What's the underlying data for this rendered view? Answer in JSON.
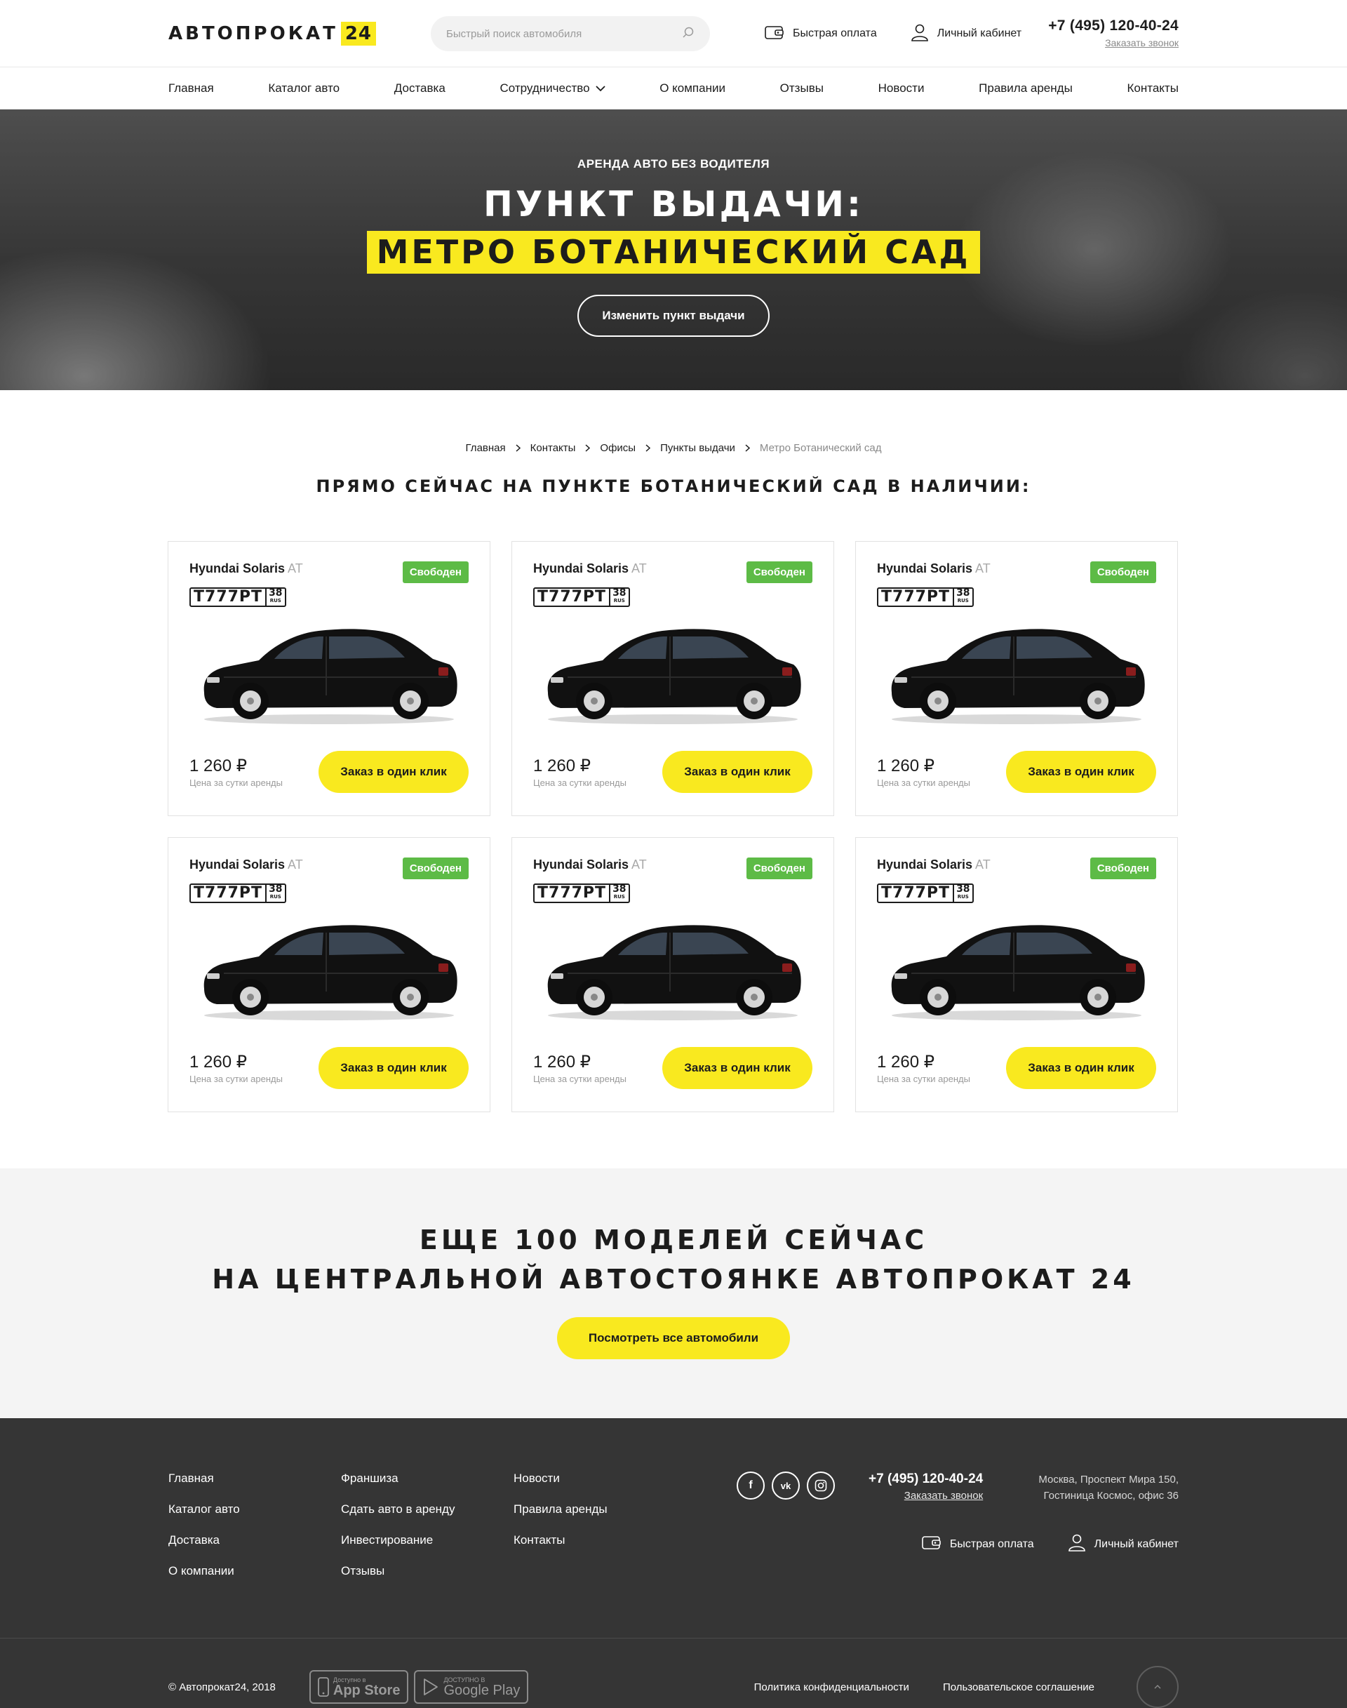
{
  "header": {
    "logo_text": "АВТОПРОКАТ",
    "logo_num": "24",
    "search_placeholder": "Быстрый поиск автомобиля",
    "pay_label": "Быстрая оплата",
    "cabinet_label": "Личный кабинет",
    "phone": "+7 (495) 120-40-24",
    "callback": "Заказать звонок"
  },
  "nav": {
    "items": [
      "Главная",
      "Каталог авто",
      "Доставка",
      "Сотрудничество",
      "О компании",
      "Отзывы",
      "Новости",
      "Правила аренды",
      "Контакты"
    ]
  },
  "hero": {
    "kicker": "АРЕНДА АВТО БЕЗ ВОДИТЕЛЯ",
    "title": "ПУНКТ ВЫДАЧИ:",
    "subtitle": "МЕТРО БОТАНИЧЕСКИЙ САД",
    "button": "Изменить пункт выдачи"
  },
  "breadcrumbs": [
    "Главная",
    "Контакты",
    "Офисы",
    "Пункты выдачи",
    "Метро Ботанический сад"
  ],
  "section_title": "ПРЯМО СЕЙЧАС НА ПУНКТЕ БОТАНИЧЕСКИЙ САД В НАЛИЧИИ:",
  "cards": [
    {
      "name": "Hyundai Solaris",
      "trans": "AT",
      "status": "Свободен",
      "plate": "Т777РТ",
      "region": "38",
      "rus": "RUS",
      "price": "1 260 ₽",
      "price_note": "Цена за сутки аренды",
      "button": "Заказ в один клик"
    },
    {
      "name": "Hyundai Solaris",
      "trans": "AT",
      "status": "Свободен",
      "plate": "Т777РТ",
      "region": "38",
      "rus": "RUS",
      "price": "1 260 ₽",
      "price_note": "Цена за сутки аренды",
      "button": "Заказ в один клик"
    },
    {
      "name": "Hyundai Solaris",
      "trans": "AT",
      "status": "Свободен",
      "plate": "Т777РТ",
      "region": "38",
      "rus": "RUS",
      "price": "1 260 ₽",
      "price_note": "Цена за сутки аренды",
      "button": "Заказ в один клик"
    },
    {
      "name": "Hyundai Solaris",
      "trans": "AT",
      "status": "Свободен",
      "plate": "Т777РТ",
      "region": "38",
      "rus": "RUS",
      "price": "1 260 ₽",
      "price_note": "Цена за сутки аренды",
      "button": "Заказ в один клик"
    },
    {
      "name": "Hyundai Solaris",
      "trans": "AT",
      "status": "Свободен",
      "plate": "Т777РТ",
      "region": "38",
      "rus": "RUS",
      "price": "1 260 ₽",
      "price_note": "Цена за сутки аренды",
      "button": "Заказ в один клик"
    },
    {
      "name": "Hyundai Solaris",
      "trans": "AT",
      "status": "Свободен",
      "plate": "Т777РТ",
      "region": "38",
      "rus": "RUS",
      "price": "1 260 ₽",
      "price_note": "Цена за сутки аренды",
      "button": "Заказ в один клик"
    }
  ],
  "more": {
    "line1": "ЕЩЕ 100 МОДЕЛЕЙ СЕЙЧАС",
    "line2": "НА ЦЕНТРАЛЬНОЙ АВТОСТОЯНКЕ АВТОПРОКАТ 24",
    "button": "Посмотреть все автомобили"
  },
  "footer": {
    "col1": [
      "Главная",
      "Каталог авто",
      "Доставка",
      "О компании"
    ],
    "col2": [
      "Франшиза",
      "Сдать авто в аренду",
      "Инвестирование",
      "Отзывы"
    ],
    "col3": [
      "Новости",
      "Правила аренды",
      "Контакты"
    ],
    "socials": [
      "facebook-icon",
      "vk-icon",
      "instagram-icon"
    ],
    "phone": "+7 (495) 120-40-24",
    "callback": "Заказать звонок",
    "address_line1": "Москва, Проспект Мира 150,",
    "address_line2": "Гостиница Космос, офис 36",
    "pay_label": "Быстрая оплата",
    "cabinet_label": "Личный кабинет",
    "copyright": "© Автопрокат24, 2018",
    "appstore_small": "Доступно в",
    "appstore": "App Store",
    "gplay_small": "ДОСТУПНО В",
    "gplay": "Google Play",
    "privacy": "Политика конфиденциальности",
    "agreement": "Пользовательское соглашение"
  },
  "colors": {
    "accent": "#f9e91f",
    "status_green": "#5dbb46",
    "footer_bg": "#353535",
    "light_bg": "#f4f4f4"
  }
}
